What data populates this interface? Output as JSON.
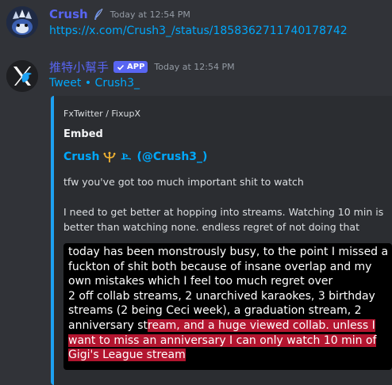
{
  "messages": [
    {
      "author": "Crush",
      "author_color": "#5865f2",
      "timestamp": "Today at 12:54 PM",
      "link": "https://x.com/Crush3_/status/1858362711740178742",
      "avatar_icon": "blue-creature-avatar",
      "badge_icon": "feather-icon"
    },
    {
      "author": "推特小幫手",
      "author_color": "#5865f2",
      "badge": "APP",
      "timestamp": "Today at 12:54 PM",
      "link": "Tweet • Crush3_",
      "avatar_icon": "x-twitter-avatar",
      "embed": {
        "accent_color": "#1da1f2",
        "provider": "FxTwitter / FixupX",
        "title": "Embed",
        "author_name": "Crush",
        "author_suffix": "(@Crush3_)",
        "description_1": "tfw you've got too much important shit to watch",
        "description_2": "I need to get better at hopping into streams. Watching 10 min is better than watching none. endless regret of not doing that",
        "image_text_plain_1": "today has been monstrously busy, to the point I missed a fuckton of shit both because of insane overlap and my own mistakes which I feel too much regret over",
        "image_text_plain_2": "2 off collab streams, 2 unarchived karaokes, 3 birthday streams (2 being Ceci week), a graduation stream, 2 anniversary st",
        "image_text_highlight": "ream,  and a huge viewed collab. unless I want to miss an anniversary I can only watch 10 min of Gigi's League stream",
        "highlight_color": "#b3152f"
      }
    }
  ]
}
